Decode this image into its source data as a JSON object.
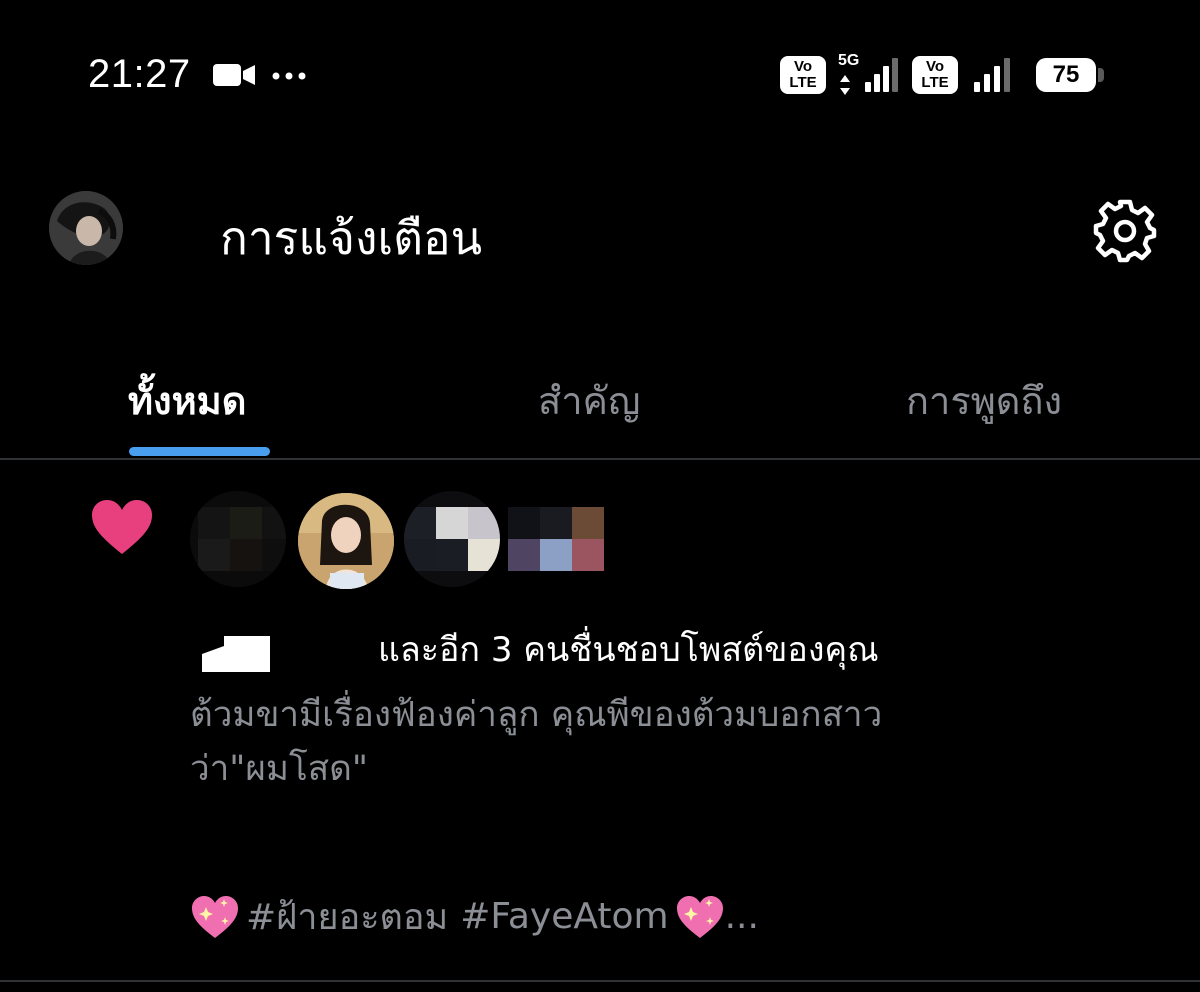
{
  "status_bar": {
    "time": "21:27",
    "network_type": "5G",
    "volte_top": "Vo",
    "volte_bottom": "LTE",
    "battery_level": "75"
  },
  "header": {
    "title": "การแจ้งเตือน",
    "avatar_icon": "profile-avatar",
    "settings_icon": "gear-icon"
  },
  "tabs": {
    "items": [
      {
        "label": "ทั้งหมด",
        "active": true
      },
      {
        "label": "สำคัญ",
        "active": false
      },
      {
        "label": "การพูดถึง",
        "active": false
      }
    ],
    "accent_color": "#4a9ef0"
  },
  "notification": {
    "type_icon": "heart-icon",
    "heart_color": "#e8407f",
    "likes_text": "และอีก 3 คนชื่นชอบโพสต์ของคุณ",
    "post_lines": [
      "ต้วมขามีเรื่องฟ้องค่าลูก คุณพีของต้วมบอกสาว",
      "ว่า\"ผมโสด\""
    ],
    "hashtags": [
      "#ฝ้ายอะตอม",
      "#FayeAtom"
    ],
    "ellipsis": "..."
  },
  "colors": {
    "background": "#000000",
    "primary_text": "#ffffff",
    "secondary_text": "#8b8f95",
    "divider": "#2f3336"
  }
}
